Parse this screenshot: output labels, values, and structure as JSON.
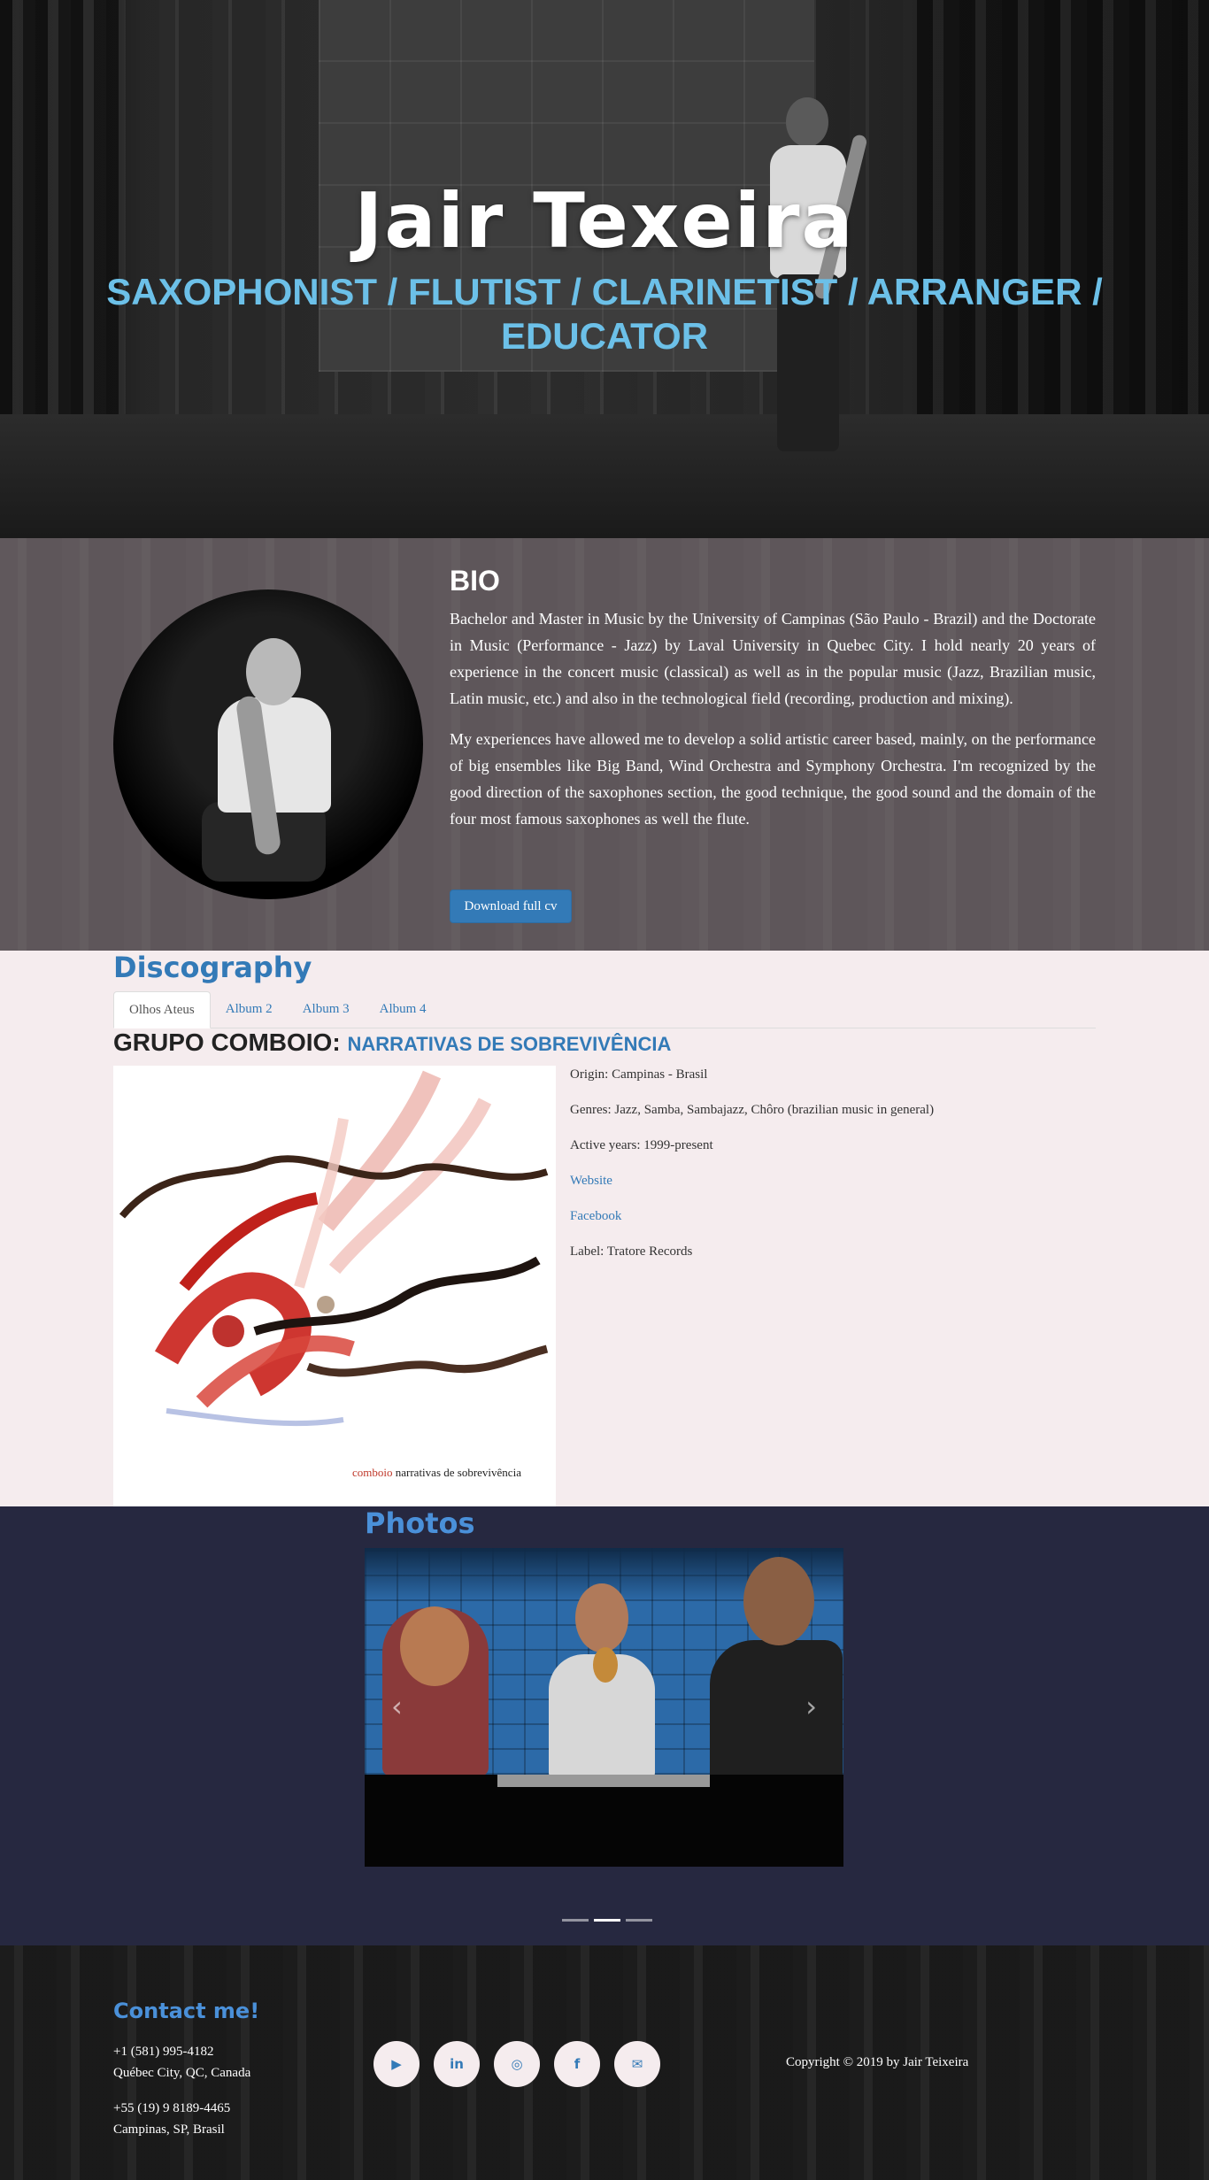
{
  "hero": {
    "title": "Jair Texeira",
    "subtitle": "SAXOPHONIST / FLUTIST / CLARINETIST / ARRANGER / EDUCATOR"
  },
  "bio": {
    "heading": "BIO",
    "paragraphs": [
      "Bachelor and Master in Music by the University of Campinas (São Paulo - Brazil) and the Doctorate in Music (Performance - Jazz) by Laval University in Quebec City. I hold nearly 20 years of experience in the concert music (classical) as well as in the popular music (Jazz, Brazilian music, Latin music, etc.) and also in the technological field (recording, production and mixing).",
      "My experiences have allowed me to develop a solid artistic career based, mainly, on the performance of big ensembles like Big Band, Wind Orchestra and Symphony Orchestra. I'm recognized by the good direction of the saxophones section, the good technique, the good sound and the domain of the four most famous saxophones as well the flute."
    ],
    "cv_button": "Download full cv"
  },
  "discography": {
    "title": "Discography",
    "tabs": [
      "Olhos Ateus",
      "Album 2",
      "Album 3",
      "Album 4"
    ],
    "active_tab": "Olhos Ateus",
    "album": {
      "group": "GRUPO COMBOIO:",
      "name": "NARRATIVAS DE SOBREVIVÊNCIA",
      "cover_caption_band": "comboio",
      "cover_caption_title": "narrativas de sobrevivência",
      "origin": "Origin: Campinas - Brasil",
      "genres": "Genres: Jazz, Samba, Sambajazz, Chôro (brazilian music in general)",
      "active_years": "Active years: 1999-present",
      "website": "Website",
      "facebook": "Facebook",
      "label": "Label: Tratore Records"
    }
  },
  "photos": {
    "title": "Photos",
    "prev": "‹",
    "next": "›",
    "active_index": 1,
    "count": 3
  },
  "footer": {
    "contact_title": "Contact me!",
    "phone_ca": "+1 (581) 995-4182",
    "city_ca": "Québec City, QC, Canada",
    "phone_br": "+55 (19) 9 8189-4465",
    "city_br": "Campinas, SP, Brasil",
    "social": {
      "youtube": "▶",
      "linkedin": "in",
      "instagram": "◎",
      "facebook": "f",
      "email": "✉"
    },
    "copyright": "Copyright © 2019 by Jair Teixeira"
  },
  "colors": {
    "accent": "#337ab7",
    "subtitle": "#6cc0e8",
    "disco_bg": "#f5ecee",
    "photos_bg": "#262840"
  }
}
